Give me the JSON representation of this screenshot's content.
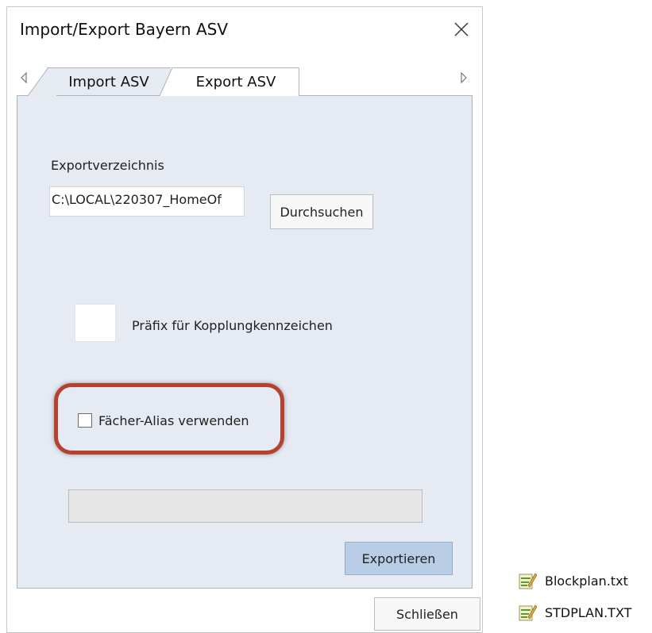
{
  "window": {
    "title": "Import/Export Bayern ASV",
    "close_icon": "close-icon"
  },
  "tabs": [
    {
      "label": "Import ASV",
      "active": false
    },
    {
      "label": "Export ASV",
      "active": true
    }
  ],
  "tab_nav": {
    "left_icon": "caret-left-icon",
    "right_icon": "caret-right-icon"
  },
  "export": {
    "directory_label": "Exportverzeichnis",
    "directory_value": "C:\\LOCAL\\220307_HomeOf",
    "browse_label": "Durchsuchen",
    "prefix_value": "",
    "prefix_label": "Präfix für Kopplungkennzeichen",
    "alias_checkbox_label": "Fächer-Alias verwenden",
    "alias_checked": false,
    "progress": 0,
    "export_button_label": "Exportieren"
  },
  "footer": {
    "close_button_label": "Schließen"
  },
  "desktop_files": [
    {
      "name": "Blockplan.txt",
      "icon": "text-file-icon"
    },
    {
      "name": "STDPLAN.TXT",
      "icon": "text-file-icon"
    }
  ],
  "colors": {
    "panel_bg": "#e6eaf2",
    "primary_button": "#b9cde6",
    "highlight_ring": "#b5412f"
  }
}
